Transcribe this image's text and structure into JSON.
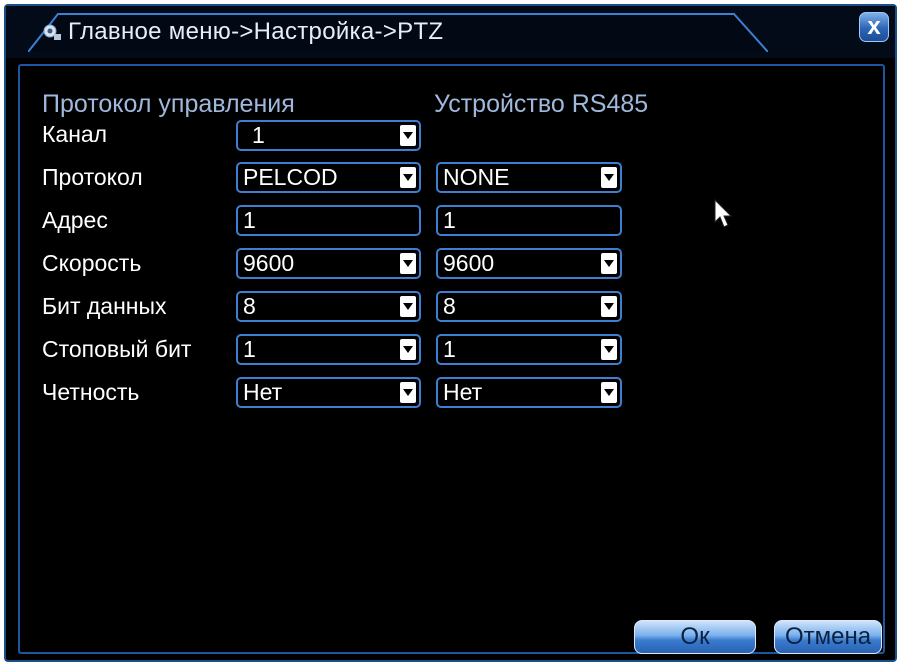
{
  "window": {
    "title": "Главное меню->Настройка->PTZ",
    "title_icon": "camera-icon",
    "close_icon": "close-icon",
    "close_label": "x"
  },
  "columns": {
    "control_protocol": "Протокол управления",
    "rs485_device": "Устройство RS485"
  },
  "rows": {
    "channel": {
      "label": "Канал",
      "value": "1"
    },
    "protocol": {
      "label": "Протокол",
      "value": "PELCOD",
      "rs485_value": "NONE"
    },
    "address": {
      "label": "Адрес",
      "value": "1",
      "rs485_value": "1"
    },
    "speed": {
      "label": "Скорость",
      "value": "9600",
      "rs485_value": "9600"
    },
    "data_bits": {
      "label": "Бит данных",
      "value": "8",
      "rs485_value": "8"
    },
    "stop_bit": {
      "label": "Стоповый бит",
      "value": "1",
      "rs485_value": "1"
    },
    "parity": {
      "label": "Четность",
      "value": "Нет",
      "rs485_value": "Нет"
    }
  },
  "buttons": {
    "ok": "Ок",
    "cancel": "Отмена"
  },
  "colors": {
    "field_border": "#3d7fd1",
    "window_border": "#1a4f8a",
    "header_text": "#9fb8dc",
    "background": "#000000"
  }
}
